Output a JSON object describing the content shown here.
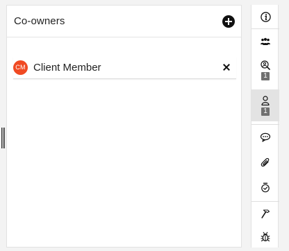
{
  "coowners": {
    "title": "Co-owners",
    "members": [
      {
        "initials": "CM",
        "name": "Client Member",
        "avatar_color": "#f04a23"
      }
    ]
  },
  "rail": {
    "items": [
      {
        "icon": "info-icon"
      },
      {
        "icon": "team-icon"
      },
      {
        "icon": "watcher-icon",
        "badge": "1"
      },
      {
        "icon": "owner-icon",
        "badge": "1",
        "active": true
      },
      {
        "icon": "comment-icon"
      },
      {
        "icon": "attachment-icon"
      },
      {
        "icon": "timer-icon"
      },
      {
        "icon": "hammer-icon"
      },
      {
        "icon": "bug-icon"
      }
    ]
  }
}
